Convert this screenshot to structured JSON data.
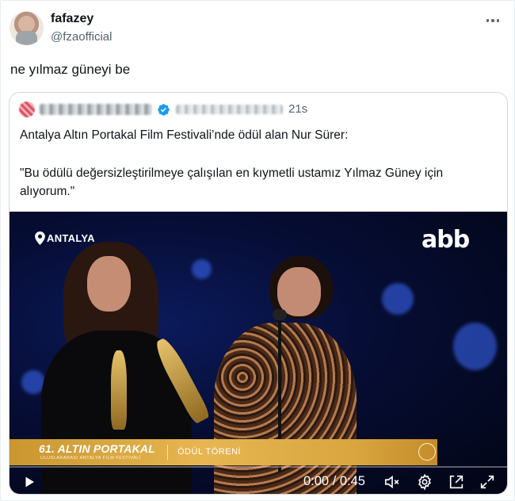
{
  "tweet": {
    "display_name": "fafazey",
    "handle": "@fzaofficial",
    "text": "ne yılmaz güneyi be"
  },
  "quoted_tweet": {
    "timestamp": "21s",
    "verified": true,
    "text_line1": "Antalya Altın Portakal Film Festivali’nde ödül alan Nur Sürer:",
    "text_quote": "\"Bu ödülü değersizleştirilmeye çalışılan en kıymetli ustamız Yılmaz Güney için alıyorum.\""
  },
  "video": {
    "overlay_logo_left": "ANTALYA",
    "overlay_logo_right": "abb",
    "lower_third_title": "61. ALTIN PORTAKAL",
    "lower_third_subtitle": "ULUSLARARASI ANTALYA FİLM FESTİVALİ",
    "lower_third_label": "ÖDÜL TÖRENİ",
    "time_display": "0:00 / 0:45",
    "progress": 0,
    "icons": {
      "play": "play-icon",
      "volume": "muted-icon",
      "settings": "gear-icon",
      "popout": "popout-icon",
      "fullscreen": "fullscreen-icon"
    }
  },
  "colors": {
    "text_primary": "#0f1419",
    "text_secondary": "#536471",
    "verified_blue": "#1d9bf0",
    "border": "#cfd9de",
    "lower_third_gold": "#e7b652"
  }
}
